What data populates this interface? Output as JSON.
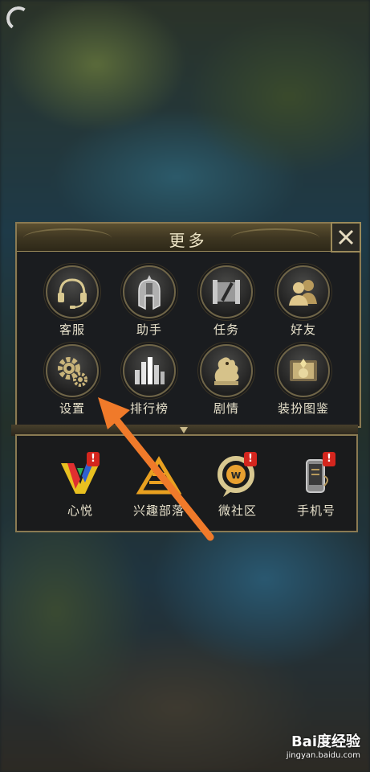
{
  "panel": {
    "title": "更多",
    "items": [
      {
        "label": "客服",
        "icon": "headset-icon"
      },
      {
        "label": "助手",
        "icon": "helmet-icon"
      },
      {
        "label": "任务",
        "icon": "scroll-icon"
      },
      {
        "label": "好友",
        "icon": "friends-icon"
      },
      {
        "label": "设置",
        "icon": "gear-icon"
      },
      {
        "label": "排行榜",
        "icon": "ranking-icon"
      },
      {
        "label": "剧情",
        "icon": "dragon-icon"
      },
      {
        "label": "装扮图鉴",
        "icon": "dress-book-icon"
      }
    ]
  },
  "links": {
    "items": [
      {
        "label": "心悦",
        "icon": "xinyue-icon",
        "badge": "!"
      },
      {
        "label": "兴趣部落",
        "icon": "tribe-icon",
        "badge": ""
      },
      {
        "label": "微社区",
        "icon": "community-icon",
        "badge": "!"
      },
      {
        "label": "手机号",
        "icon": "phone-icon",
        "badge": "!"
      }
    ]
  },
  "watermark": {
    "main": "Bai度经验",
    "sub": "jingyan.baidu.com"
  },
  "colors": {
    "gold": "#c9b98a",
    "arrow": "#f07a2a",
    "badge": "#d4261e"
  }
}
